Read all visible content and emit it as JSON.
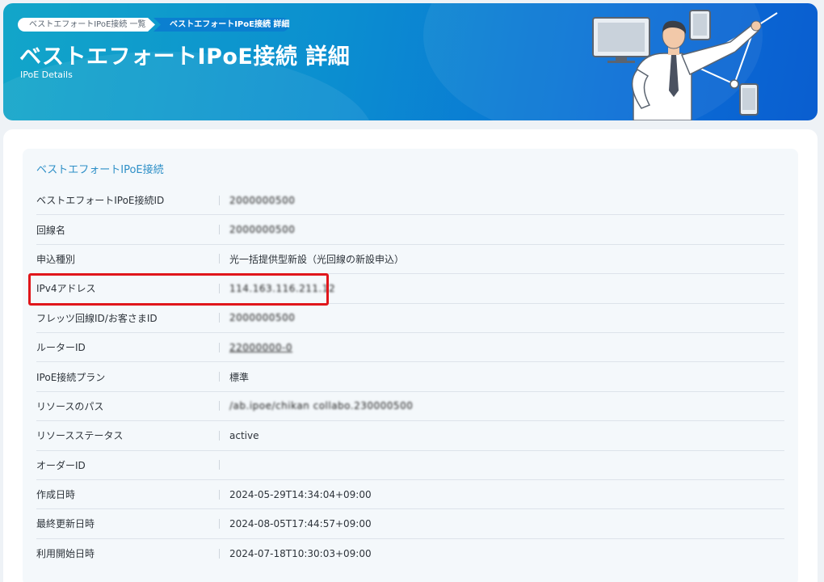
{
  "breadcrumb": {
    "items": [
      {
        "label": "ベストエフォートIPoE接続 一覧"
      },
      {
        "label": "ベストエフォートIPoE接続 詳細"
      }
    ]
  },
  "header": {
    "title": "ベストエフォートIPoE接続 詳細",
    "subtitle": "IPoE Details"
  },
  "section": {
    "title": "ベストエフォートIPoE接続"
  },
  "details": [
    {
      "label": "ベストエフォートIPoE接続ID",
      "value": "2000000500"
    },
    {
      "label": "回線名",
      "value": "2000000500"
    },
    {
      "label": "申込種別",
      "value": "光一括提供型新設（光回線の新設申込）"
    },
    {
      "label": "IPv4アドレス",
      "value": "114.163.116.211.12"
    },
    {
      "label": "フレッツ回線ID/お客さまID",
      "value": "2000000500"
    },
    {
      "label": "ルーターID",
      "value": "22000000-0"
    },
    {
      "label": "IPoE接続プラン",
      "value": "標準"
    },
    {
      "label": "リソースのパス",
      "value": "/ab.ipoe/chikan collabo.230000500"
    },
    {
      "label": "リソースステータス",
      "value": "active"
    },
    {
      "label": "オーダーID",
      "value": ""
    },
    {
      "label": "作成日時",
      "value": "2024-05-29T14:34:04+09:00"
    },
    {
      "label": "最終更新日時",
      "value": "2024-08-05T17:44:57+09:00"
    },
    {
      "label": "利用開始日時",
      "value": "2024-07-18T10:30:03+09:00"
    }
  ],
  "colors": {
    "accent": "#2d8fc7",
    "highlight": "#e0161b",
    "banner": "#0b8fd0"
  }
}
